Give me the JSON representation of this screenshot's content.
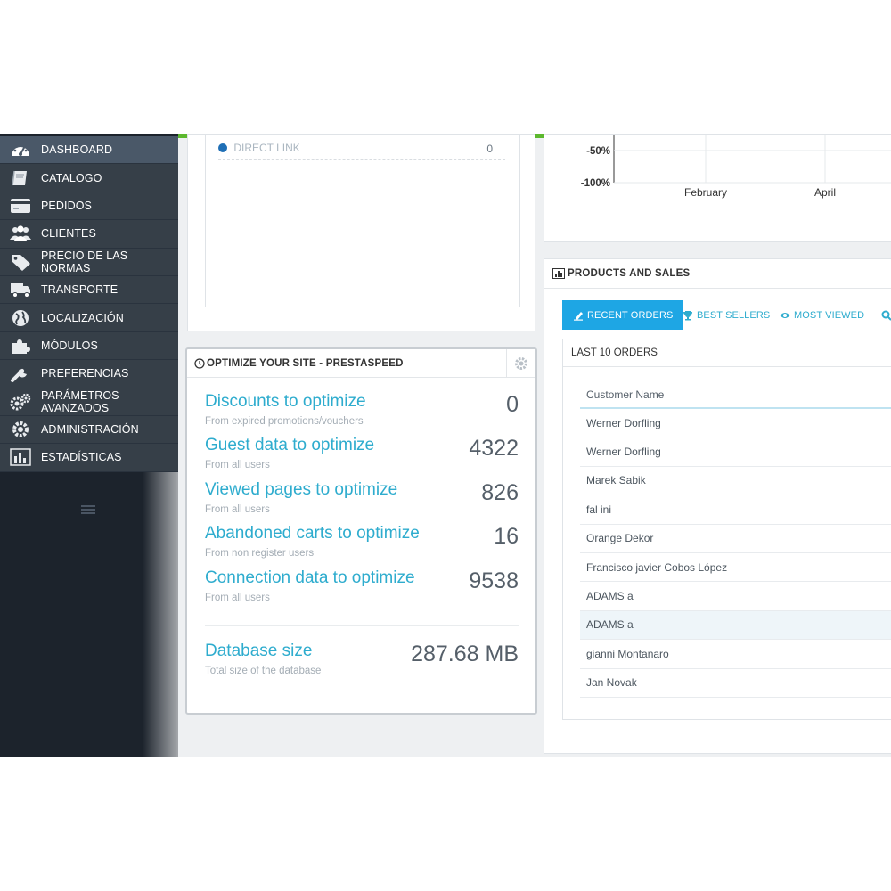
{
  "sidebar": {
    "items": [
      {
        "label": "DASHBOARD",
        "icon": "dashboard-icon",
        "active": true
      },
      {
        "label": "CATALOGO",
        "icon": "book-icon"
      },
      {
        "label": "PEDIDOS",
        "icon": "credit-card-icon"
      },
      {
        "label": "CLIENTES",
        "icon": "users-icon"
      },
      {
        "label": "PRECIO DE LAS NORMAS",
        "icon": "tag-icon"
      },
      {
        "label": "TRANSPORTE",
        "icon": "truck-icon"
      },
      {
        "label": "LOCALIZACIÓN",
        "icon": "globe-icon"
      },
      {
        "label": "MÓDULOS",
        "icon": "puzzle-icon"
      },
      {
        "label": "PREFERENCIAS",
        "icon": "wrench-icon"
      },
      {
        "label": "PARÁMETROS AVANZADOS",
        "icon": "gears-icon"
      },
      {
        "label": "ADMINISTRACIÓN",
        "icon": "gear-icon"
      },
      {
        "label": "ESTADÍSTICAS",
        "icon": "bar-chart-icon"
      }
    ]
  },
  "direct_link": {
    "label": "DIRECT LINK",
    "value": "0"
  },
  "optimize": {
    "title": "OPTIMIZE YOUR SITE - PRESTASPEED",
    "rows": [
      {
        "title": "Discounts to optimize",
        "sub": "From expired promotions/vouchers",
        "value": "0"
      },
      {
        "title": "Guest data to optimize",
        "sub": "From all users",
        "value": "4322"
      },
      {
        "title": "Viewed pages to optimize",
        "sub": "From all users",
        "value": "826"
      },
      {
        "title": "Abandoned carts to optimize",
        "sub": "From non register users",
        "value": "16"
      },
      {
        "title": "Connection data to optimize",
        "sub": "From all users",
        "value": "9538"
      }
    ],
    "db": {
      "title": "Database size",
      "sub": "Total size of the database",
      "value": "287.68 MB"
    }
  },
  "chart_data": {
    "type": "line",
    "y_ticks": [
      "-50%",
      "-100%"
    ],
    "x_ticks": [
      "February",
      "April"
    ]
  },
  "products": {
    "title": "PRODUCTS AND SALES",
    "tabs": [
      "RECENT ORDERS",
      "BEST SELLERS",
      "MOST VIEWED"
    ],
    "orders_title": "LAST 10 ORDERS",
    "column": "Customer Name",
    "customers": [
      "Werner Dorfling",
      "Werner Dorfling",
      "Marek Sabik",
      "fal ini",
      "Orange Dekor",
      "Francisco javier Cobos López",
      "ADAMS a",
      "ADAMS a",
      "gianni Montanaro",
      "Jan Novak"
    ]
  },
  "colors": {
    "accent": "#2eacce",
    "tab_active": "#1ea6e4",
    "top_bar": "#5cb82e",
    "sidebar": "#363f48"
  }
}
